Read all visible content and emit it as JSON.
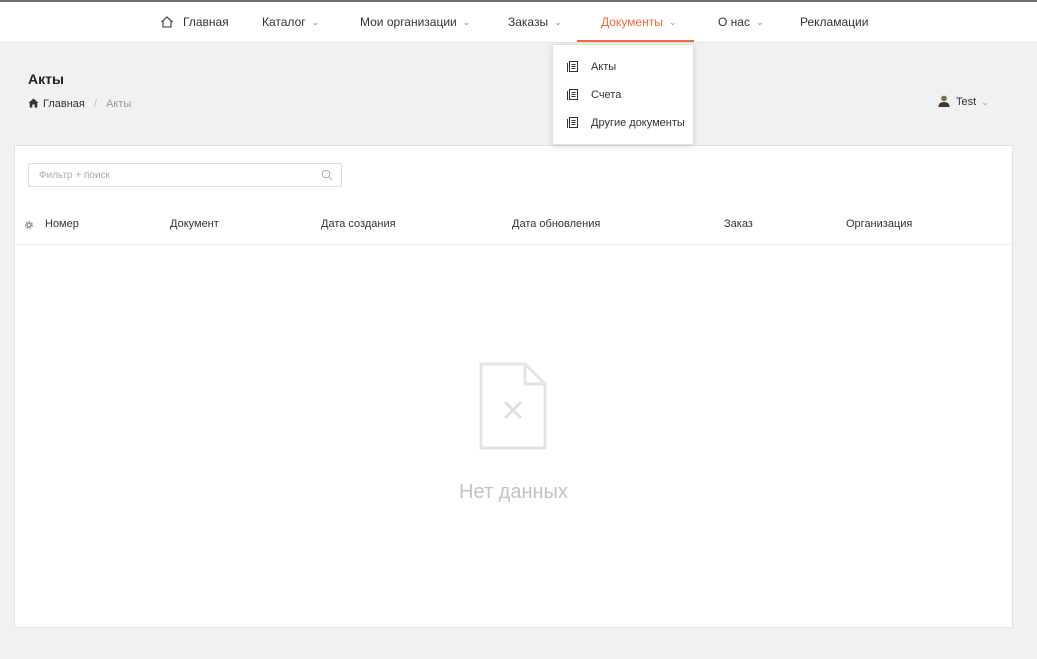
{
  "nav": {
    "home": "Главная",
    "catalog": "Каталог",
    "organizations": "Мои организации",
    "orders": "Заказы",
    "documents": "Документы",
    "about": "О нас",
    "claims": "Рекламации",
    "chevron": "⌄",
    "active_color": "#f26b3a"
  },
  "documents_menu": {
    "items": [
      {
        "label": "Акты",
        "icon": "document-list-icon"
      },
      {
        "label": "Счета",
        "icon": "document-list-icon"
      },
      {
        "label": "Другие документы",
        "icon": "document-list-icon"
      }
    ]
  },
  "page": {
    "title": "Акты",
    "breadcrumb": {
      "home": "Главная",
      "separator": "/",
      "current": "Акты"
    }
  },
  "user": {
    "name": "Test",
    "chevron": "⌄"
  },
  "filter": {
    "placeholder": "Фильтр + поиск"
  },
  "table": {
    "columns": [
      "Номер",
      "Документ",
      "Дата создания",
      "Дата обновления",
      "Заказ",
      "Организация"
    ]
  },
  "empty": {
    "text": "Нет данных"
  }
}
